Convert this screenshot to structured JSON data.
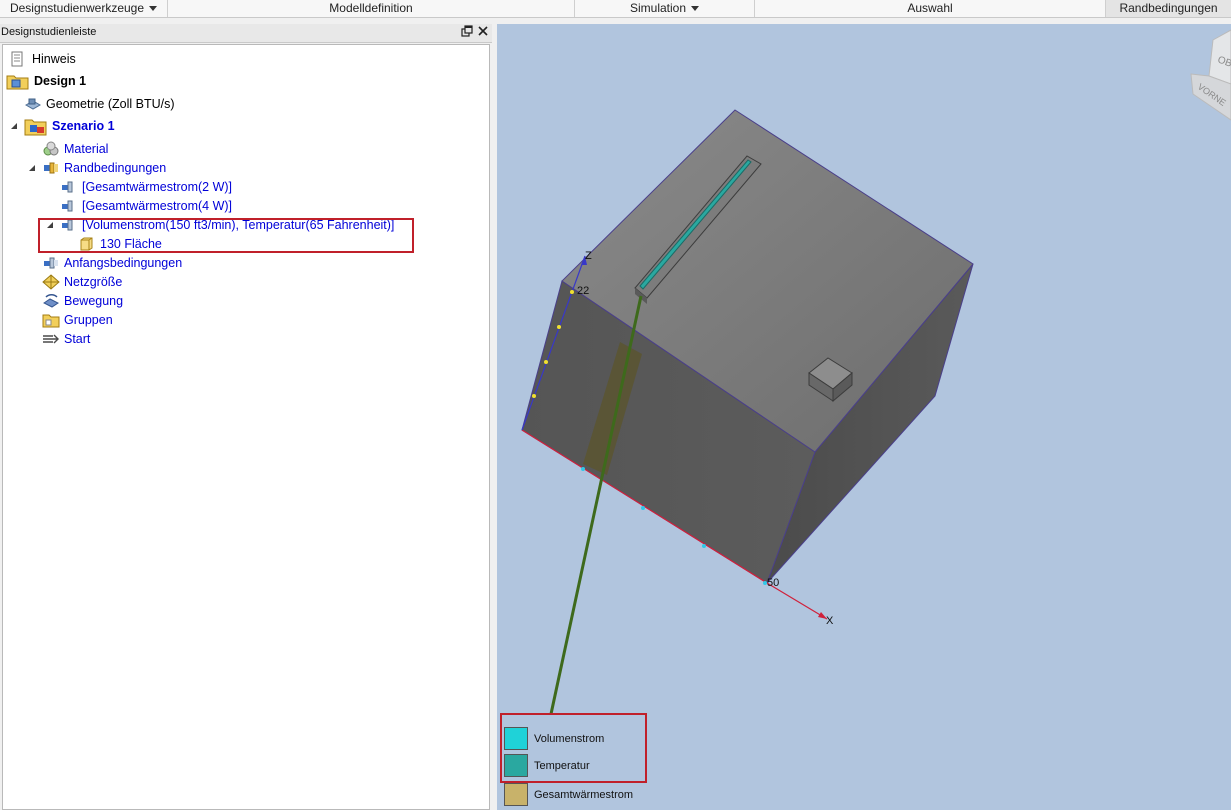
{
  "toolbar": {
    "items": [
      "Designstudienwerkzeuge",
      "Modelldefinition",
      "Simulation",
      "Auswahl",
      "Randbedingungen"
    ]
  },
  "panel": {
    "title": "Designstudienleiste",
    "pin_icon": "restore-icon",
    "close_icon": "close-icon"
  },
  "tree": {
    "hinweis": "Hinweis",
    "design": "Design 1",
    "geometrie": "Geometrie (Zoll BTU/s)",
    "szenario": "Szenario 1",
    "material": "Material",
    "randbedingungen": "Randbedingungen",
    "rb1": "[Gesamtwärmestrom(2 W)]",
    "rb2": "[Gesamtwärmestrom(4 W)]",
    "rb3": "[Volumenstrom(150 ft3/min), Temperatur(65 Fahrenheit)]",
    "flaeche": "130 Fläche",
    "anfangsbedingungen": "Anfangsbedingungen",
    "netzgroesse": "Netzgröße",
    "bewegung": "Bewegung",
    "gruppen": "Gruppen",
    "start": "Start"
  },
  "viewport": {
    "axis_z": "Z",
    "axis_x": "X",
    "label_22": "22",
    "label_50": "50",
    "viewcube_top": "OB",
    "viewcube_front": "VORNE"
  },
  "legend": {
    "items": [
      {
        "label": "Volumenstrom",
        "color": "#1fd2d8"
      },
      {
        "label": "Temperatur",
        "color": "#2aa8a0"
      },
      {
        "label": "Gesamtwärmestrom",
        "color": "#c8b26a"
      }
    ]
  }
}
